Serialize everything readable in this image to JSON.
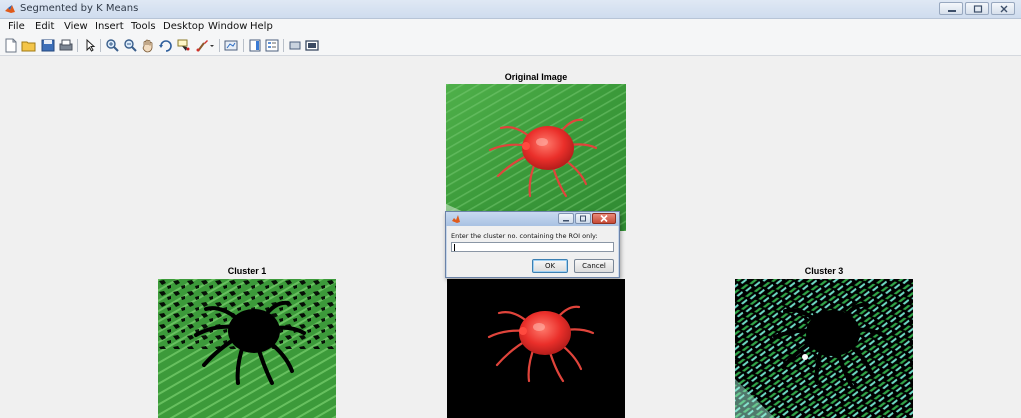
{
  "window": {
    "title": "Segmented by K Means",
    "icon": "matlab-icon",
    "controls": [
      "minimize-icon",
      "maximize-icon",
      "close-icon"
    ]
  },
  "menubar": {
    "items": [
      {
        "label": "File"
      },
      {
        "label": "Edit"
      },
      {
        "label": "View"
      },
      {
        "label": "Insert"
      },
      {
        "label": "Tools"
      },
      {
        "label": "Desktop"
      },
      {
        "label": "Window"
      },
      {
        "label": "Help"
      }
    ]
  },
  "toolbar": {
    "icons": [
      "new-figure-icon",
      "open-file-icon",
      "save-icon",
      "print-icon",
      "pointer-icon",
      "zoom-in-icon",
      "zoom-out-icon",
      "pan-hand-icon",
      "rotate-3d-icon",
      "data-cursor-icon",
      "brush-icon",
      "link-plot-icon",
      "colorbar-icon",
      "legend-icon",
      "hide-plot-tools-icon",
      "show-plot-tools-icon"
    ]
  },
  "figure": {
    "original_title": "Original Image",
    "cluster1_title": "Cluster 1",
    "cluster3_title": "Cluster 3"
  },
  "dialog": {
    "prompt": "Enter the cluster no. containing the ROI only:",
    "input_value": "",
    "ok_label": "OK",
    "cancel_label": "Cancel"
  },
  "colors": {
    "leaf_green": "#3f9a3a",
    "mite_red": "#e8322c",
    "dialog_close_red": "#c74a36"
  }
}
